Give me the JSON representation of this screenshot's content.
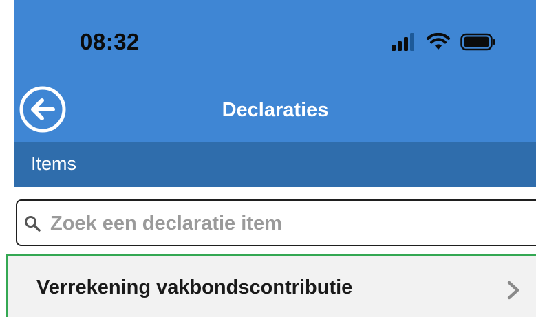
{
  "status_bar": {
    "time": "08:32"
  },
  "header": {
    "title": "Declaraties",
    "back_icon": "back-arrow-circle-icon"
  },
  "section": {
    "label": "Items"
  },
  "search": {
    "placeholder": "Zoek een declaratie item",
    "value": ""
  },
  "items": [
    {
      "label": "Verrekening vakbondscontributie"
    }
  ],
  "colors": {
    "header_bg": "#3f86d4",
    "section_bg": "#2f6dac",
    "item_highlight_border": "#34a853",
    "item_bg": "#f2f2f2"
  }
}
